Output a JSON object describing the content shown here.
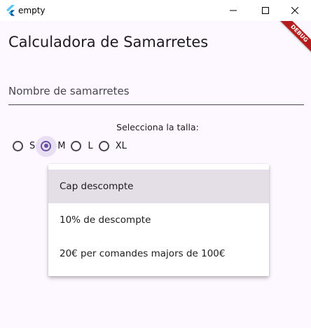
{
  "window": {
    "title": "empty",
    "controls": [
      "minimize",
      "maximize",
      "close"
    ]
  },
  "debug_banner": "DEBUG",
  "app": {
    "title": "Calculadora de Samarretes",
    "name_field": {
      "placeholder": "Nombre de samarretes",
      "value": ""
    },
    "size_selector": {
      "label": "Selecciona la talla:",
      "options": [
        {
          "label": "S",
          "selected": false
        },
        {
          "label": "M",
          "selected": true
        },
        {
          "label": "L",
          "selected": false
        },
        {
          "label": "XL",
          "selected": false
        }
      ]
    },
    "discount_menu": {
      "items": [
        {
          "label": "Cap descompte",
          "highlighted": true
        },
        {
          "label": "10% de descompte",
          "highlighted": false
        },
        {
          "label": "20€ per comandes majors de 100€",
          "highlighted": false
        }
      ]
    }
  },
  "colors": {
    "background": "#fdf7ff",
    "accent": "#6750a4",
    "debug_ribbon": "#b71c1c",
    "menu_highlight": "#e4dee6"
  }
}
